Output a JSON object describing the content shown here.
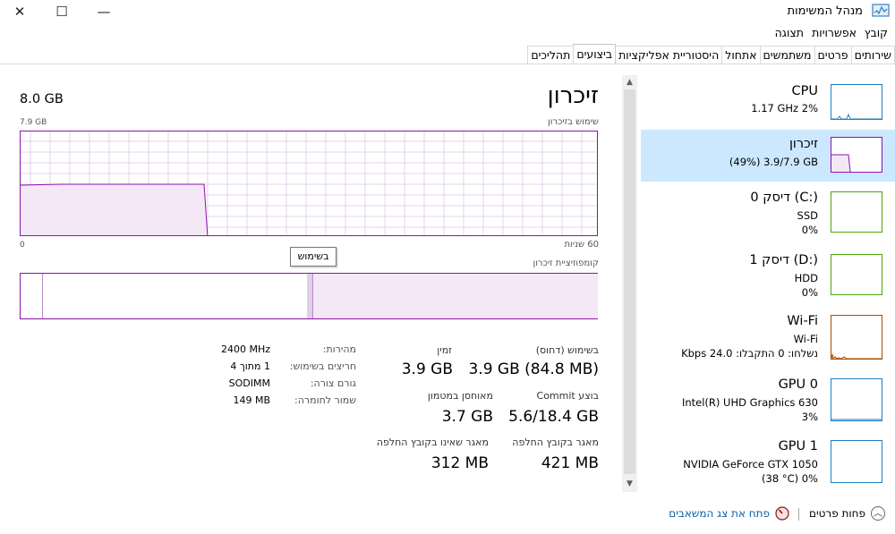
{
  "window": {
    "title": "מנהל המשימות",
    "close_glyph": "✕",
    "maximize_glyph": "☐",
    "minimize_glyph": "—"
  },
  "menu": [
    "קובץ",
    "אפשרויות",
    "תצוגה"
  ],
  "tabs": [
    "תהליכים",
    "ביצועים",
    "היסטוריית אפליקציות",
    "אתחול",
    "משתמשים",
    "פרטים",
    "שירותים"
  ],
  "active_tab": "ביצועים",
  "sidebar": [
    {
      "name": "CPU",
      "line1": "1.17 GHz  2%",
      "line2": "",
      "selected": false,
      "color": "#1e7fbf"
    },
    {
      "name": "זיכרון",
      "line1": "(49%) 3.9/7.9 GB",
      "line2": "",
      "selected": true,
      "color": "#8b12ae"
    },
    {
      "name": "דיסק 0 (C:)",
      "line1": "SSD",
      "line2": "0%",
      "selected": false,
      "color": "#4da60c"
    },
    {
      "name": "דיסק 1 (D:)",
      "line1": "HDD",
      "line2": "0%",
      "selected": false,
      "color": "#4da60c"
    },
    {
      "name": "Wi-Fi",
      "line1": "Wi-Fi",
      "line2": "נשלחו: 0 התקבלו: 24.0 Kbps",
      "selected": false,
      "color": "#a74f01"
    },
    {
      "name": "GPU 0",
      "line1": "Intel(R) UHD Graphics 630",
      "line2": "3%",
      "selected": false,
      "color": "#1e7fbf"
    },
    {
      "name": "GPU 1",
      "line1": "NVIDIA GeForce GTX 1050",
      "line2": "(38 °C)  0%",
      "selected": false,
      "color": "#1e7fbf"
    }
  ],
  "main": {
    "title": "זיכרון",
    "total": "8.0 GB",
    "usage_label": "שימוש בזיכרון",
    "graph_max": "7.9 GB",
    "graph_left_label": "60 שניות",
    "graph_right_label": "0",
    "composition_label": "קומפוזיציית זיכרון",
    "tooltip": "בשימוש",
    "stats": {
      "in_use_label": "בשימוש (דחוס)",
      "in_use_value": "3.9 GB (84.8 MB)",
      "available_label": "זמין",
      "available_value": "3.9 GB",
      "committed_label": "בוצע Commit",
      "committed_value": "5.6/18.4 GB",
      "cached_label": "מאוחסן במטמון",
      "cached_value": "3.7 GB",
      "paged_label": "מאגר בקובץ החלפה",
      "paged_value": "421 MB",
      "nonpaged_label": "מאגר שאינו בקובץ החלפה",
      "nonpaged_value": "312 MB"
    },
    "specs": [
      {
        "label": "מהירות:",
        "value": "2400 MHz"
      },
      {
        "label": "חריצים בשימוש:",
        "value": "1 מתוך 4"
      },
      {
        "label": "גורם צורה:",
        "value": "SODIMM"
      },
      {
        "label": "שמור לחומרה:",
        "value": "149 MB"
      }
    ],
    "memory_usage_fraction": 0.49
  },
  "footer": {
    "fewer_details": "פחות פרטים",
    "open_resmon": "פתח את צג המשאבים"
  }
}
